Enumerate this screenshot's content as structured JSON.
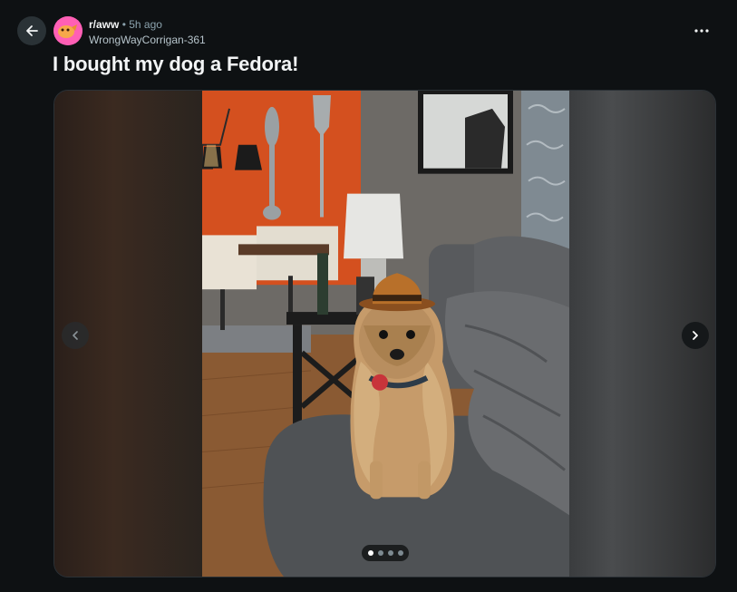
{
  "post": {
    "subreddit": "r/aww",
    "separator": "•",
    "time": "5h ago",
    "author": "WrongWayCorrigan-361",
    "title": "I bought my dog a Fedora!"
  },
  "icons": {
    "back": "arrow-left-icon",
    "more": "more-horizontal-icon",
    "prev": "chevron-left-icon",
    "next": "chevron-right-icon"
  },
  "gallery": {
    "total_images": 4,
    "current_index": 1
  },
  "colors": {
    "background": "#0e1113",
    "accent_avatar": "#ff5fb5",
    "wall_orange": "#d4501f",
    "fedora": "#b8702a"
  }
}
